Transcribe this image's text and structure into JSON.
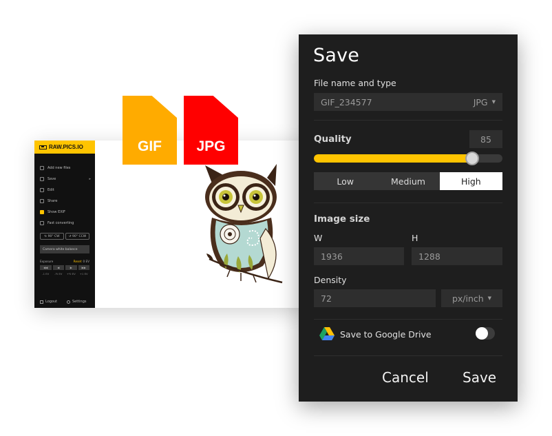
{
  "app": {
    "brand": "RAW.PICS.IO",
    "menu": [
      {
        "label": "Add new files",
        "icon": "add-files-icon"
      },
      {
        "label": "Save",
        "icon": "download-icon"
      },
      {
        "label": "Edit",
        "icon": "pencil-icon"
      },
      {
        "label": "Share",
        "icon": "share-icon"
      },
      {
        "label": "Show EXIF",
        "icon": "checkbox-checked-icon"
      },
      {
        "label": "Fast converting",
        "icon": "checkbox-icon"
      }
    ],
    "rotate_cw": "90° CW",
    "rotate_ccw": "90° CCW",
    "camera_wb": "Camera white balance",
    "exposure_label": "Exposure",
    "exposure_reset": "Reset",
    "exposure_value": "0 EV",
    "exposure_values": [
      "-1 EV",
      "-½ EV",
      "+½ EV",
      "+1 EV"
    ],
    "logout": "Logout",
    "settings": "Settings"
  },
  "badges": {
    "gif": "GIF",
    "jpg": "JPG"
  },
  "dialog": {
    "title": "Save",
    "file_section": "File name and type",
    "file_name": "GIF_234577",
    "file_type": "JPG",
    "quality_label": "Quality",
    "quality_value": "85",
    "quality_level": 0.84,
    "quality_options": [
      "Low",
      "Medium",
      "High"
    ],
    "quality_selected": "High",
    "size_section": "Image size",
    "width_label": "W",
    "height_label": "H",
    "width_value": "1936",
    "height_value": "1288",
    "density_label": "Density",
    "density_value": "72",
    "density_unit": "px/inch",
    "gdrive_label": "Save to Google Drive",
    "gdrive_enabled": false,
    "cancel": "Cancel",
    "save": "Save"
  },
  "colors": {
    "accent": "#ffc400",
    "gif_badge": "#ffab00",
    "jpg_badge": "#ff0000",
    "dialog_bg": "#1e1e1e"
  }
}
